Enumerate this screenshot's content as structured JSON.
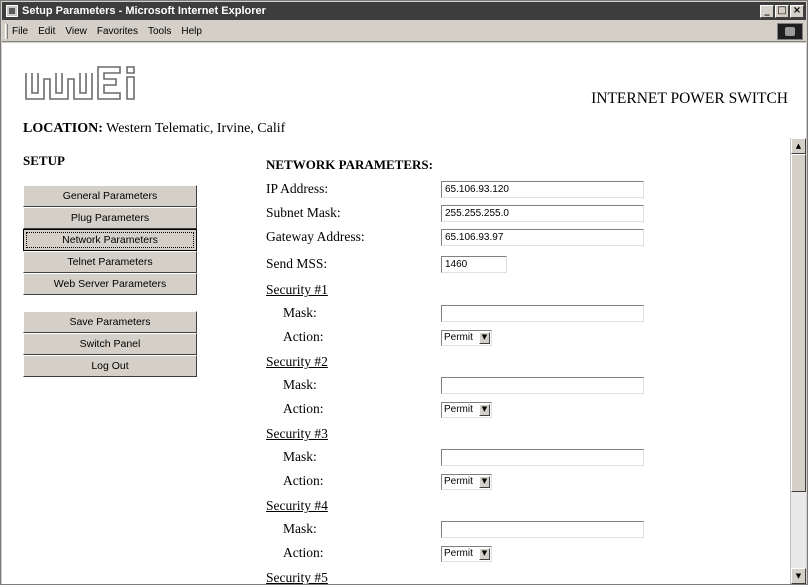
{
  "window": {
    "title": "Setup Parameters - Microsoft Internet Explorer",
    "controls": {
      "minimize": "_",
      "maximize": "□",
      "close": "×"
    }
  },
  "menubar": {
    "items": [
      "File",
      "Edit",
      "View",
      "Favorites",
      "Tools",
      "Help"
    ]
  },
  "header": {
    "logo_text": "wti",
    "banner": "INTERNET POWER SWITCH",
    "location_label": "LOCATION:",
    "location_value": "Western Telematic, Irvine, Calif"
  },
  "sidebar": {
    "heading": "SETUP",
    "group1": [
      {
        "label": "General Parameters",
        "active": false
      },
      {
        "label": "Plug Parameters",
        "active": false
      },
      {
        "label": "Network Parameters",
        "active": true
      },
      {
        "label": "Telnet Parameters",
        "active": false
      },
      {
        "label": "Web Server Parameters",
        "active": false
      }
    ],
    "group2": [
      {
        "label": "Save Parameters"
      },
      {
        "label": "Switch Panel"
      },
      {
        "label": "Log Out"
      }
    ]
  },
  "form": {
    "heading": "NETWORK PARAMETERS:",
    "ip_label": "IP Address:",
    "ip_value": "65.106.93.120",
    "subnet_label": "Subnet Mask:",
    "subnet_value": "255.255.255.0",
    "gateway_label": "Gateway Address:",
    "gateway_value": "65.106.93.97",
    "mss_label": "Send MSS:",
    "mss_value": "1460",
    "security": [
      {
        "title": "Security #1",
        "mask_label": "Mask:",
        "mask_value": "",
        "action_label": "Action:",
        "action_value": "Permit"
      },
      {
        "title": "Security #2",
        "mask_label": "Mask:",
        "mask_value": "",
        "action_label": "Action:",
        "action_value": "Permit"
      },
      {
        "title": "Security #3",
        "mask_label": "Mask:",
        "mask_value": "",
        "action_label": "Action:",
        "action_value": "Permit"
      },
      {
        "title": "Security #4",
        "mask_label": "Mask:",
        "mask_value": "",
        "action_label": "Action:",
        "action_value": "Permit"
      },
      {
        "title": "Security #5"
      }
    ]
  },
  "colors": {
    "chrome": "#d4d0c8",
    "titlebar": "#3d3d3d",
    "page_bg": "#ffffff"
  },
  "icons": {
    "scroll_up": "scroll-up-icon",
    "scroll_down": "scroll-down-icon",
    "dropdown": "chevron-down-icon"
  }
}
